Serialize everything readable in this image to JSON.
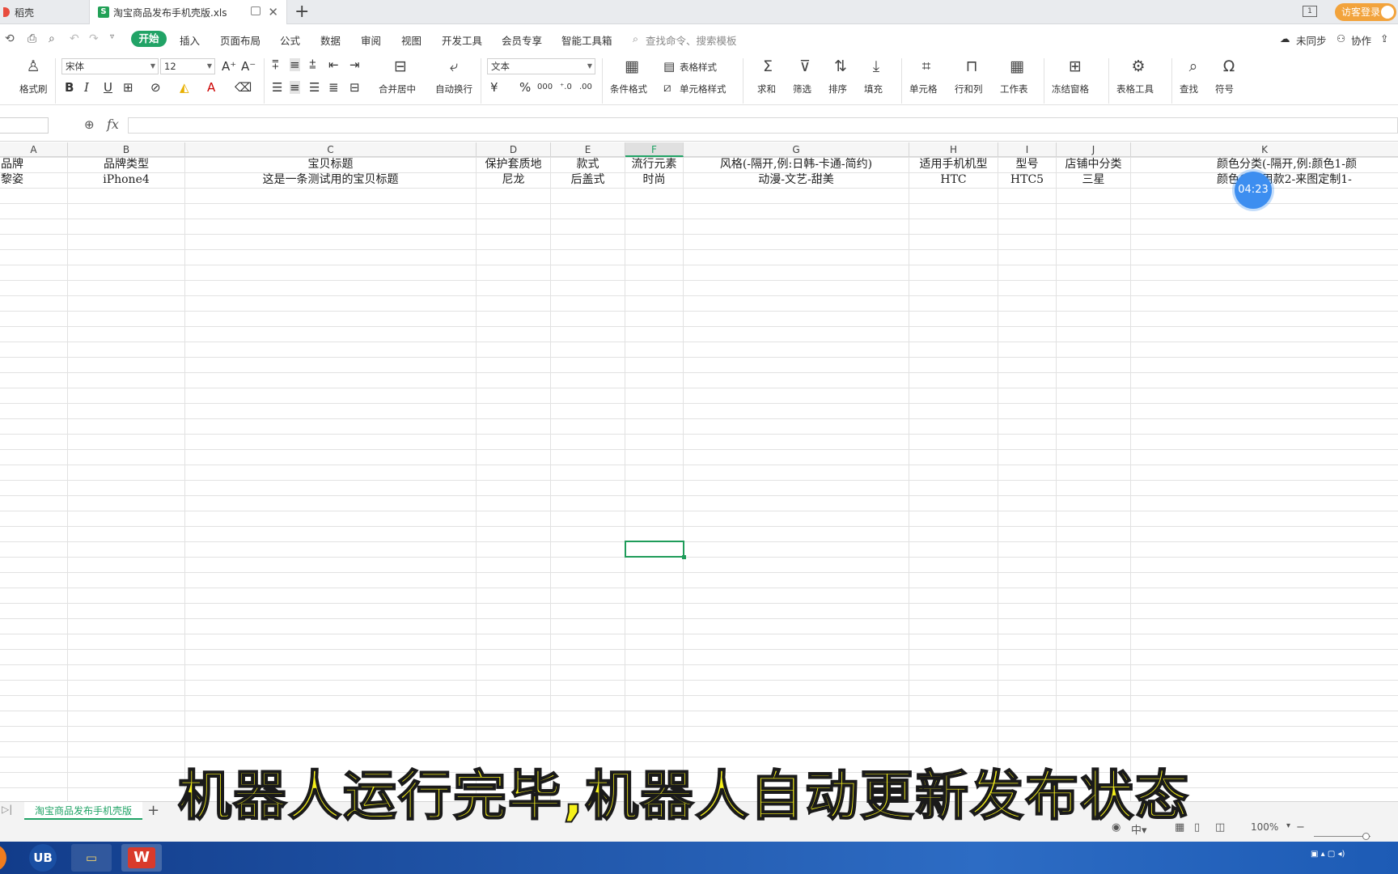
{
  "tabs": {
    "home": "稻壳",
    "doc": "淘宝商品发布手机壳版.xls"
  },
  "header": {
    "visitor": "访客登录",
    "win_num": "1"
  },
  "menu": {
    "start": "开始",
    "insert": "插入",
    "layout": "页面布局",
    "formula": "公式",
    "data": "数据",
    "review": "审阅",
    "view": "视图",
    "dev": "开发工具",
    "member": "会员专享",
    "tools": "智能工具箱",
    "search": "查找命令、搜索模板",
    "sync": "未同步",
    "collab": "协作"
  },
  "ribbon": {
    "format_painter": "格式刷",
    "font_name": "宋体",
    "font_size": "12",
    "merge": "合并居中",
    "wrap": "自动换行",
    "num_format": "文本",
    "cond_format": "条件格式",
    "table_style": "表格样式",
    "cell_style": "单元格样式",
    "sum": "求和",
    "filter": "筛选",
    "sort": "排序",
    "fill": "填充",
    "cell": "单元格",
    "rowcol": "行和列",
    "sheet": "工作表",
    "freeze": "冻结窗格",
    "table_tools": "表格工具",
    "find": "查找",
    "symbol": "符号",
    "bold": "B",
    "italic": "I",
    "underline": "U",
    "currency": "¥",
    "percent": "%",
    "thousands": "000"
  },
  "formula_bar": {
    "fx": "fx"
  },
  "columns": [
    "A",
    "B",
    "C",
    "D",
    "E",
    "F",
    "G",
    "H",
    "I",
    "J",
    "K"
  ],
  "rows": [
    [
      "品牌",
      "品牌类型",
      "宝贝标题",
      "保护套质地",
      "款式",
      "流行元素",
      "风格(-隔开,例:日韩-卡通-简约)",
      "适用手机机型",
      "型号",
      "店铺中分类",
      "颜色分类(-隔开,例:颜色1-颜"
    ],
    [
      "黎姿",
      "iPhone4",
      "这是一条测试用的宝贝标题",
      "尼龙",
      "后盖式",
      "时尚",
      "动漫-文艺-甜美",
      "HTC",
      "HTC5",
      "三星",
      "颜色1-常用款2-来图定制1-"
    ]
  ],
  "timer": "04:23",
  "subtitle": "机器人运行完毕,机器人自动更新发布状态",
  "sheet": {
    "name": "淘宝商品发布手机壳版",
    "zoom": "100%"
  },
  "taskbar": {
    "ub": "UB"
  }
}
